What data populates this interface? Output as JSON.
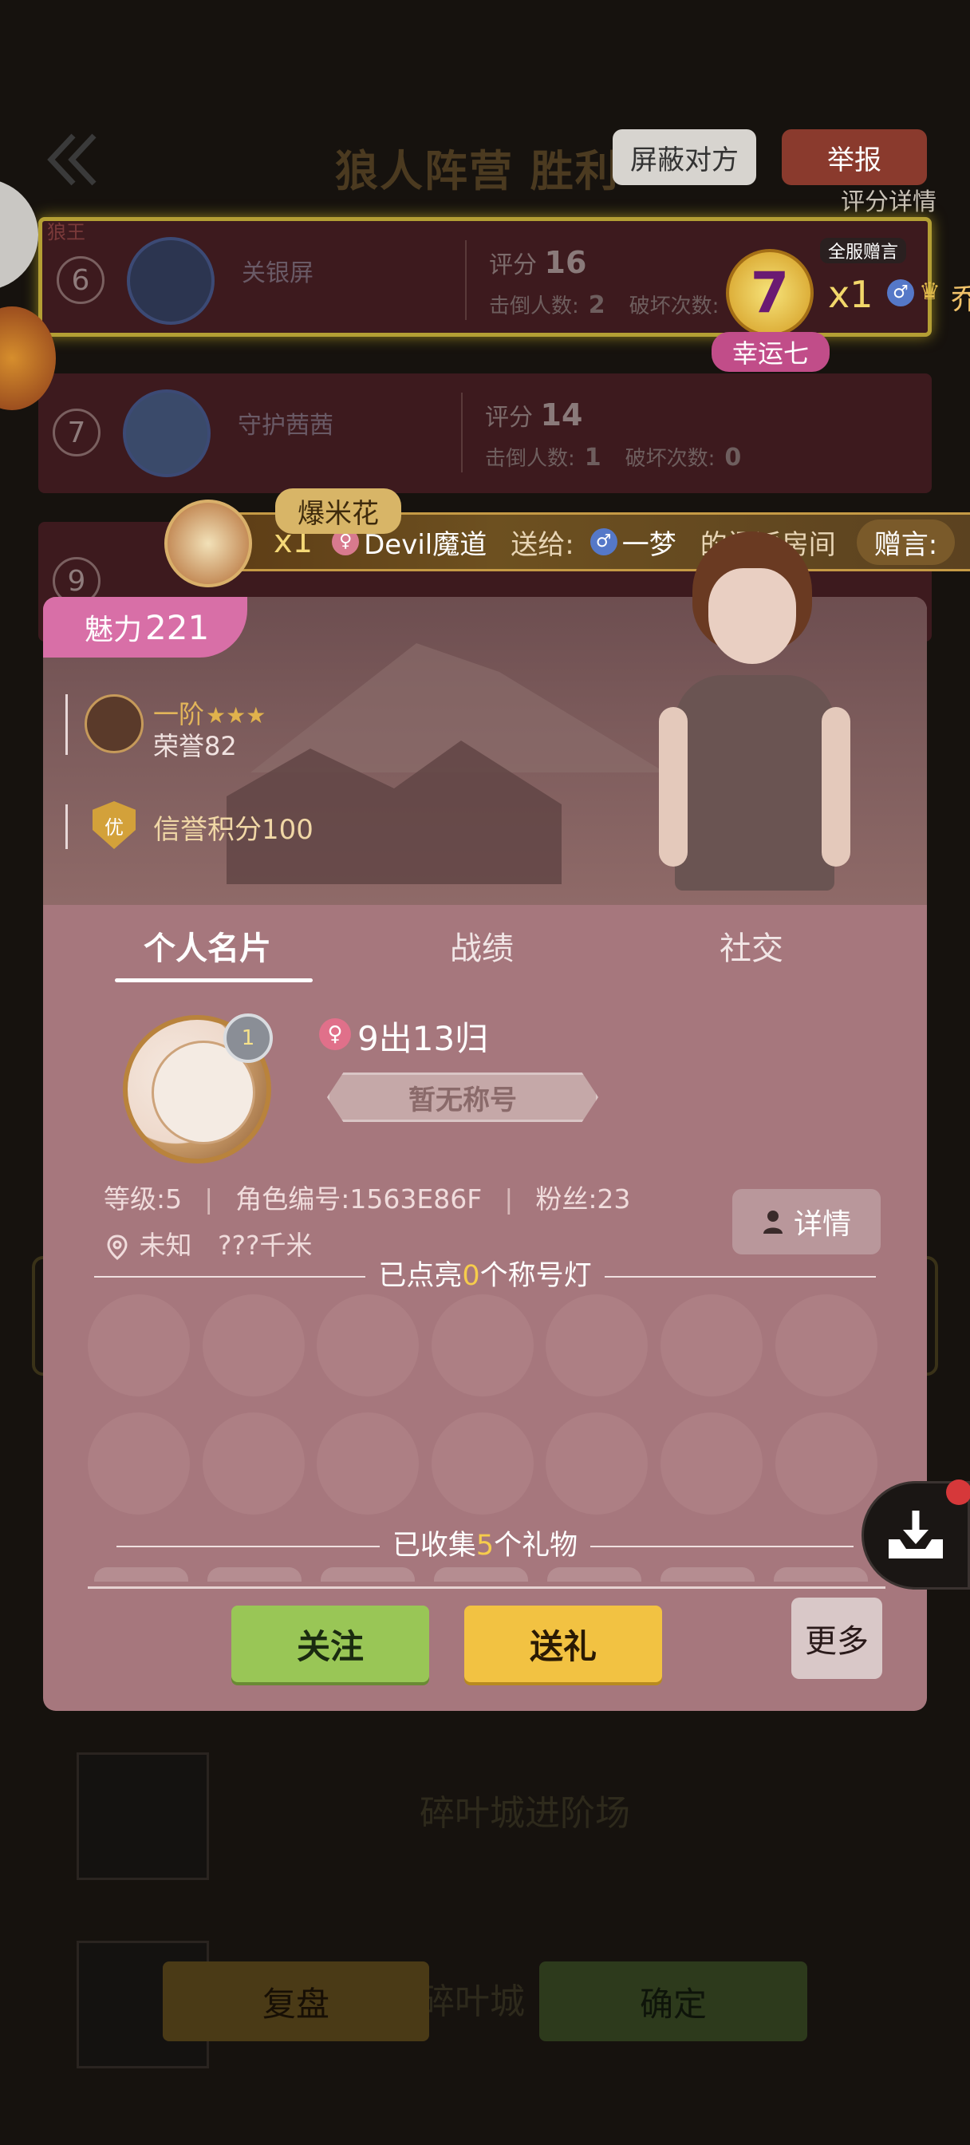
{
  "header": {
    "title": "狼人阵营 胜利",
    "shield_label": "屏蔽对方",
    "report_label": "举报",
    "score_detail": "评分详情"
  },
  "rows": [
    {
      "rank": "6",
      "tag": "狼王",
      "name": "关银屏",
      "score_label": "评分",
      "score": "16",
      "kills_label": "击倒人数:",
      "kills": "2",
      "breaks_label": "破坏次数:",
      "breaks": ""
    },
    {
      "rank": "7",
      "tag": "",
      "name": "守护茜茜",
      "score_label": "评分",
      "score": "14",
      "kills_label": "击倒人数:",
      "kills": "1",
      "breaks_label": "破坏次数:",
      "breaks": "0"
    },
    {
      "rank": "9",
      "tag": "",
      "name": "",
      "score_label": "",
      "score": "",
      "kills_label": "",
      "kills": "",
      "breaks_label": "",
      "breaks": ""
    }
  ],
  "lucky": {
    "tag": "幸运七",
    "badge": "7",
    "count": "x1",
    "full_server": "全服赠言",
    "name_fragment": "乔"
  },
  "gift_banner": {
    "gift_name": "爆米花",
    "count": "x1",
    "sender": "Devil魔道",
    "send_to": "送给:",
    "receiver": "一梦",
    "room": "的门派房间",
    "message_label": "赠言:"
  },
  "card": {
    "charm_label": "魅力",
    "charm_value": "221",
    "rank_tier": "一阶",
    "rank_stars": "★★★",
    "honor": "荣誉82",
    "credit_icon": "优",
    "credit": "信誉积分100",
    "tabs": [
      "个人名片",
      "战绩",
      "社交"
    ],
    "medal_level": "1",
    "gender_symbol": "♀",
    "out_return": "9出13归",
    "title_plate": "暂无称号",
    "level": "等级:5",
    "role_id": "角色编号:1563E86F",
    "fans": "粉丝:23",
    "location": "未知",
    "distance": "???千米",
    "detail_label": "详情",
    "lamps_prefix": "已点亮",
    "lamps_count": "0",
    "lamps_suffix": "个称号灯",
    "gifts_prefix": "已收集",
    "gifts_count": "5",
    "gifts_suffix": "个礼物",
    "follow_label": "关注",
    "gift_label": "送礼",
    "more_label": "更多"
  },
  "bottom": {
    "map_1": "碎叶城进阶场",
    "map_2": "碎叶城",
    "review_label": "复盘",
    "confirm_label": "确定"
  },
  "colors": {
    "card_bg": "#a6777d",
    "charm_pink": "#d86fa7",
    "follow_green": "#99c656",
    "gift_yellow": "#f2c242",
    "highlight_num": "#f6cc4c"
  }
}
